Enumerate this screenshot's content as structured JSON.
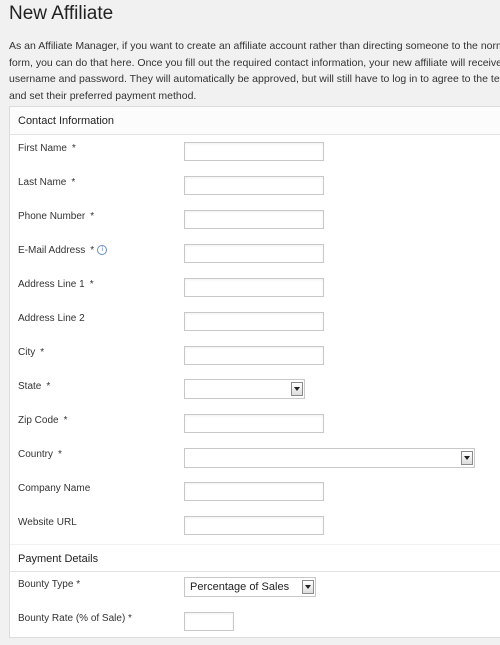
{
  "page": {
    "title": "New Affiliate",
    "intro_lines": [
      "As an Affiliate Manager, if you want to create an affiliate account rather than directing someone to the norma",
      "form, you can do that here. Once you fill out the required contact information, your new affiliate will receive a",
      "username and password. They will automatically be approved, but will still have to log in to agree to the terms",
      "and set their preferred payment method."
    ]
  },
  "contact": {
    "header": "Contact Information",
    "required_mark": "*",
    "info_icon": "i",
    "fields": {
      "first_name": "First Name",
      "last_name": "Last Name",
      "phone": "Phone Number",
      "email": "E-Mail Address",
      "address1": "Address Line 1",
      "address2": "Address Line 2",
      "city": "City",
      "state": "State",
      "zip": "Zip Code",
      "country": "Country",
      "company": "Company Name",
      "website": "Website URL"
    }
  },
  "payment": {
    "header": "Payment Details",
    "bounty_type_label": "Bounty Type *",
    "bounty_type_value": "Percentage of Sales",
    "bounty_rate_label": "Bounty Rate (% of Sale) *"
  }
}
